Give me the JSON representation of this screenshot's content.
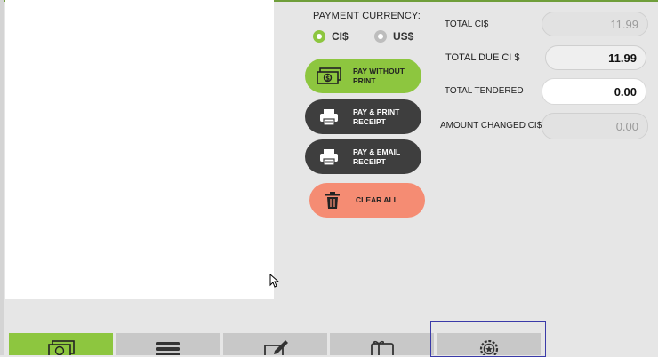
{
  "payment_currency": {
    "title": "PAYMENT CURRENCY:",
    "options": [
      {
        "label": "CI$",
        "selected": true
      },
      {
        "label": "US$",
        "selected": false
      }
    ]
  },
  "actions": {
    "pay_without_print": {
      "line1": "PAY WITHOUT",
      "line2": "PRINT",
      "icon": "cash-icon"
    },
    "pay_print_receipt": {
      "line1": "PAY & PRINT",
      "line2": "RECEIPT",
      "icon": "printer-icon"
    },
    "pay_email_receipt": {
      "line1": "PAY & EMAIL",
      "line2": "RECEIPT",
      "icon": "printer-icon"
    },
    "clear_all": {
      "label": "CLEAR ALL",
      "icon": "trash-icon"
    }
  },
  "totals": {
    "total": {
      "label": "TOTAL CI$",
      "value": "11.99"
    },
    "total_due": {
      "label": "TOTAL DUE CI $",
      "value": "11.99"
    },
    "total_tendered": {
      "label": "TOTAL TENDERED",
      "value": "0.00"
    },
    "amount_changed": {
      "label": "AMOUNT CHANGED CI$",
      "value": "0.00"
    }
  },
  "payment_tabs": [
    {
      "icon": "cash-icon",
      "active": true
    },
    {
      "icon": "card-stack-icon",
      "active": false
    },
    {
      "icon": "check-pen-icon",
      "active": false
    },
    {
      "icon": "gift-card-icon",
      "active": false
    },
    {
      "icon": "badge-icon",
      "active": false,
      "focused": true
    }
  ],
  "colors": {
    "accent_green": "#8dc63f",
    "dark_button": "#3e3e3e",
    "clear_button": "#f58c73",
    "focus_outline": "#3a3aa8"
  }
}
